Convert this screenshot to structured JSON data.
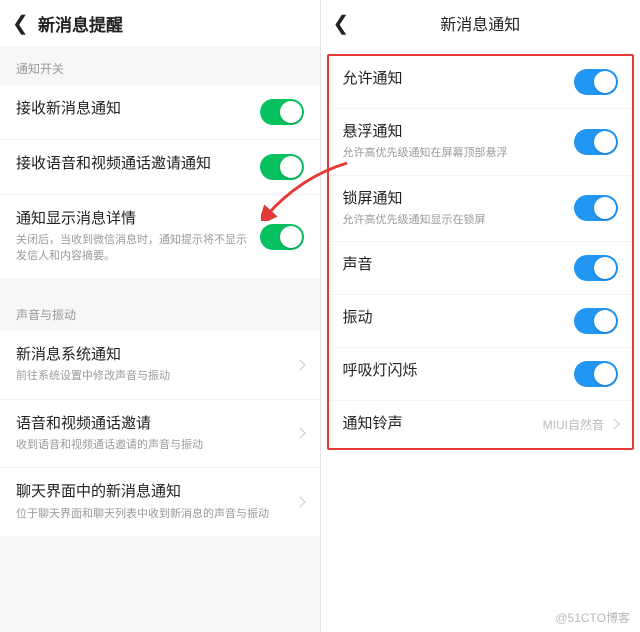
{
  "left": {
    "header_title": "新消息提醒",
    "section1_label": "通知开关",
    "row1_label": "接收新消息通知",
    "row2_label": "接收语音和视频通话邀请通知",
    "row3_label": "通知显示消息详情",
    "row3_sub": "关闭后，当收到微信消息时，通知提示将不显示发信人和内容摘要。",
    "section2_label": "声音与振动",
    "row4_label": "新消息系统通知",
    "row4_sub": "前往系统设置中修改声音与振动",
    "row5_label": "语音和视频通话邀请",
    "row5_sub": "收到语音和视频通话邀请的声音与振动",
    "row6_label": "聊天界面中的新消息通知",
    "row6_sub": "位于聊天界面和聊天列表中收到新消息的声音与振动"
  },
  "right": {
    "header_title": "新消息通知",
    "rows": {
      "r1_label": "允许通知",
      "r2_label": "悬浮通知",
      "r2_sub": "允许高优先级通知在屏幕顶部悬浮",
      "r3_label": "锁屏通知",
      "r3_sub": "允许高优先级通知显示在锁屏",
      "r4_label": "声音",
      "r5_label": "振动",
      "r6_label": "呼吸灯闪烁",
      "r7_label": "通知铃声",
      "r7_value": "MIUI自然音"
    }
  },
  "watermark": "@51CTO博客"
}
